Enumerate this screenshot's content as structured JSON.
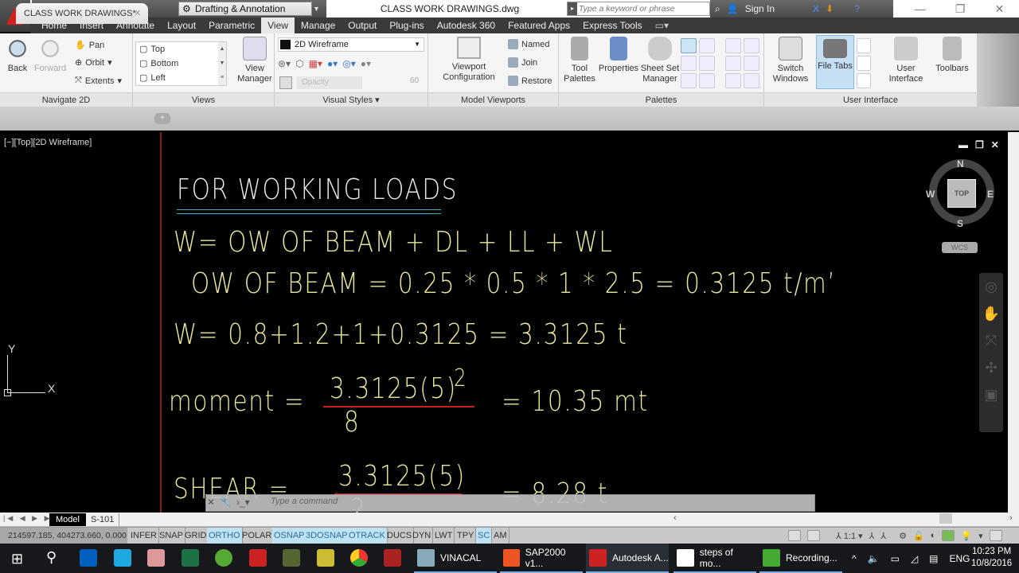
{
  "titlebar": {
    "workspace": "Drafting & Annotation",
    "document_title": "CLASS WORK DRAWINGS.dwg",
    "search_placeholder": "Type a keyword or phrase",
    "sign_in": "Sign In"
  },
  "ribbon_tabs": [
    {
      "label": "Home"
    },
    {
      "label": "Insert"
    },
    {
      "label": "Annotate"
    },
    {
      "label": "Layout"
    },
    {
      "label": "Parametric"
    },
    {
      "label": "View",
      "active": true
    },
    {
      "label": "Manage"
    },
    {
      "label": "Output"
    },
    {
      "label": "Plug-ins"
    },
    {
      "label": "Autodesk 360"
    },
    {
      "label": "Featured Apps"
    },
    {
      "label": "Express Tools"
    }
  ],
  "ribbon": {
    "navigate2d": {
      "title": "Navigate 2D",
      "back": "Back",
      "forward": "Forward",
      "pan": "Pan",
      "orbit": "Orbit",
      "extents": "Extents"
    },
    "views": {
      "title": "Views",
      "list": [
        "Top",
        "Bottom",
        "Left"
      ],
      "view_manager": "View\nManager",
      "view_manager_l1": "View",
      "view_manager_l2": "Manager"
    },
    "visual_styles": {
      "title": "Visual Styles",
      "current": "2D Wireframe",
      "opacity_label": "Opacity",
      "opacity_value": "60"
    },
    "model_viewports": {
      "title": "Model Viewports",
      "config_l1": "Viewport",
      "config_l2": "Configuration",
      "named": "Named",
      "join": "Join",
      "restore": "Restore"
    },
    "palettes": {
      "title": "Palettes",
      "tool_l1": "Tool",
      "tool_l2": "Palettes",
      "properties": "Properties",
      "ssm_l1": "Sheet Set",
      "ssm_l2": "Manager"
    },
    "user_interface": {
      "title": "User Interface",
      "switch_l1": "Switch",
      "switch_l2": "Windows",
      "file_tabs": "File Tabs",
      "ui_l1": "User",
      "ui_l2": "Interface",
      "toolbars": "Toolbars"
    }
  },
  "document_tabs": [
    {
      "label": "CLASS WORK DRAWINGS*"
    }
  ],
  "viewport": {
    "control_label": "[−][Top][2D Wireframe]",
    "viewcube": {
      "face": "TOP",
      "n": "N",
      "s": "S",
      "e": "E",
      "w": "W",
      "ucs_label": "WCS"
    },
    "ucs": {
      "x": "X",
      "y": "Y"
    },
    "drawing_text": {
      "heading": "FOR WORKING LOADS",
      "line1": "W=  OW  OF  BEAM  +  DL  +  LL  +  WL",
      "line2": "OW  OF  BEAM  =  0.25  *  0.5    *  1  *  2.5    =  0.3125  t/m’",
      "line3": "W=  0.8+1.2+1+0.3125  =  3.3125  t",
      "moment_label": "moment  =",
      "moment_numerator": "3.3125(5)",
      "moment_exponent": "2",
      "moment_denominator": "8",
      "moment_result": "=  10.35  mt",
      "shear_label": "SHEAR  =",
      "shear_numerator": "3.3125(5)",
      "shear_denominator": "2",
      "shear_result": "=  8.28  t"
    }
  },
  "command_line": {
    "placeholder": "Type a command"
  },
  "layout_tabs": [
    {
      "label": "Model",
      "active": true
    },
    {
      "label": "S-101"
    }
  ],
  "status_bar": {
    "coordinates": "214597.185, 404273.660, 0.000",
    "toggles": [
      {
        "label": "INFER",
        "on": false
      },
      {
        "label": "SNAP",
        "on": false
      },
      {
        "label": "GRID",
        "on": false
      },
      {
        "label": "ORTHO",
        "on": true
      },
      {
        "label": "POLAR",
        "on": false
      },
      {
        "label": "OSNAP",
        "on": true
      },
      {
        "label": "3DOSNAP",
        "on": true
      },
      {
        "label": "OTRACK",
        "on": true
      },
      {
        "label": "DUCS",
        "on": false
      },
      {
        "label": "DYN",
        "on": false
      },
      {
        "label": "LWT",
        "on": false
      },
      {
        "label": "TPY",
        "on": false
      },
      {
        "label": "SC",
        "on": true
      },
      {
        "label": "AM",
        "on": false
      }
    ],
    "annotation_scale": "1:1"
  },
  "taskbar": {
    "apps": [
      {
        "label": "VINACAL"
      },
      {
        "label": "SAP2000 v1..."
      },
      {
        "label": "Autodesk A..."
      },
      {
        "label": "steps of mo..."
      },
      {
        "label": "Recording..."
      }
    ],
    "language": "ENG",
    "time": "10:23 PM",
    "date": "10/8/2016"
  },
  "colors": {
    "drawing_text": "#e8e89a",
    "heading_text": "#e8e8e8",
    "underline": "#44aabb",
    "fraction_line": "#c82020",
    "status_on": "#bfe3f5"
  }
}
